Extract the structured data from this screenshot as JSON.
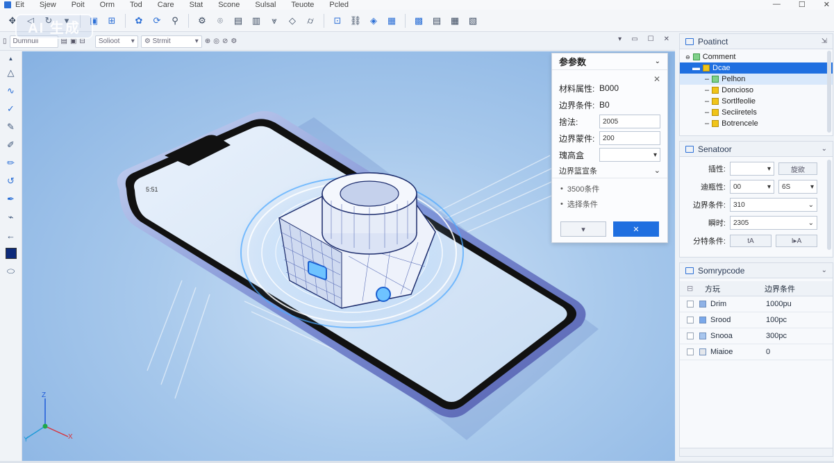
{
  "menu": {
    "items": [
      "Eit",
      "Sjew",
      "Poit",
      "Orm",
      "Tod",
      "Care",
      "Stat",
      "Scone",
      "Sulsal",
      "Teuote",
      "Pcled"
    ],
    "window_controls": [
      "—",
      "☐",
      "✕"
    ]
  },
  "watermark": {
    "text": "AI 生成"
  },
  "subbar": {
    "field1": "Dumnuii",
    "field2": "Solioot",
    "field3": "Strmit"
  },
  "param_dialog": {
    "title": "参参数",
    "rows": [
      {
        "label": "材料属性:",
        "value": "B000"
      },
      {
        "label": "边界条件:",
        "value": "B0"
      }
    ],
    "inputs": [
      {
        "label": "捨法:",
        "value": "2005"
      },
      {
        "label": "边界蒙件:",
        "value": "200"
      },
      {
        "label": "瑰高盒",
        "value": ""
      }
    ],
    "section_label": "边界篮宣条",
    "bullets": [
      "3500条件",
      "选择条件"
    ],
    "ok_icon": "▾",
    "cancel_icon": "✕"
  },
  "project_panel": {
    "title": "Poatinct",
    "tree": [
      {
        "label": "Comment",
        "level": 0,
        "icon": "green",
        "selected": false
      },
      {
        "label": "Dcae",
        "level": 1,
        "icon": "yellow",
        "selected": true
      },
      {
        "label": "Pelhon",
        "level": 2,
        "icon": "green",
        "selected": false,
        "highlight": true
      },
      {
        "label": "Doncioso",
        "level": 2,
        "icon": "yellow",
        "selected": false
      },
      {
        "label": "Sortlfeolie",
        "level": 2,
        "icon": "yellow",
        "selected": false
      },
      {
        "label": "Seciiretels",
        "level": 2,
        "icon": "yellow",
        "selected": false
      },
      {
        "label": "Botrencele",
        "level": 2,
        "icon": "yellow",
        "selected": false
      }
    ]
  },
  "properties_panel": {
    "title": "Senatoor",
    "rows": [
      {
        "label": "插性:",
        "value1": "",
        "value2": "旋欲"
      },
      {
        "label": "迪瓶性:",
        "value1": "00",
        "value2": "6S"
      },
      {
        "label": "边界条件:",
        "value1": "310"
      },
      {
        "label": "瞬时:",
        "value1": "2305"
      },
      {
        "label": "分特条件:",
        "btn1": "tA",
        "btn2": "I▸A"
      }
    ]
  },
  "summary_panel": {
    "title": "Somrypcode",
    "columns": [
      "方玩",
      "边界条件"
    ],
    "rows": [
      {
        "name": "Drim",
        "value": "1000pu",
        "color": "#8fb2e6"
      },
      {
        "name": "Srood",
        "value": "100pc",
        "color": "#7aa8ea"
      },
      {
        "name": "Snooa",
        "value": "300pc",
        "color": "#a8c6ee"
      },
      {
        "name": "Miaioe",
        "value": "0",
        "color": "#e4e7ec"
      }
    ]
  },
  "phone_status": {
    "time": "5:51"
  },
  "axis": {
    "x": "X",
    "y": "Y",
    "z": "Z"
  },
  "colors": {
    "accent": "#1f6fe0",
    "viewport_bg": "#a8c9ec"
  }
}
